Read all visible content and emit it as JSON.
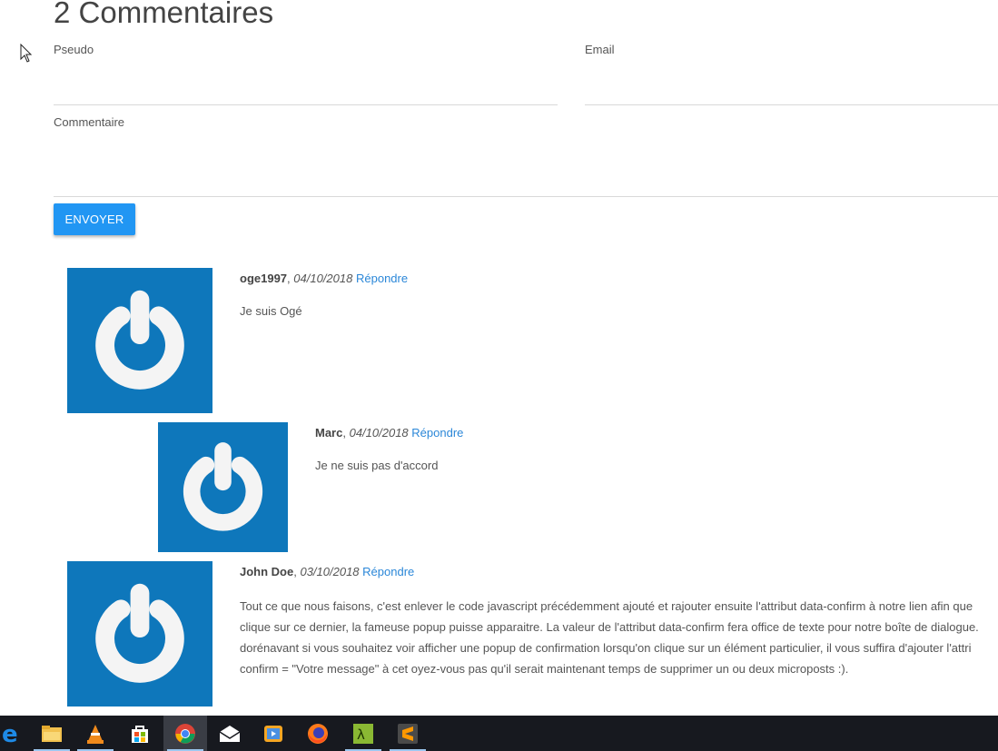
{
  "section": {
    "title": "2 Commentaires"
  },
  "form": {
    "pseudo_label": "Pseudo",
    "email_label": "Email",
    "comment_label": "Commentaire",
    "submit_label": "ENVOYER"
  },
  "comments": [
    {
      "author": "oge1997",
      "date": "04/10/2018",
      "reply": "Répondre",
      "text": "Je suis Ogé"
    },
    {
      "author": "Marc",
      "date": "04/10/2018",
      "reply": "Répondre",
      "text": "Je ne suis pas d'accord"
    },
    {
      "author": "John Doe",
      "date": "03/10/2018",
      "reply": "Répondre",
      "text_lines": [
        "Tout ce que nous faisons, c'est enlever le code javascript précédemment ajouté et rajouter ensuite l'attribut data-confirm à notre lien afin que",
        "clique sur ce dernier, la fameuse popup puisse apparaitre. La valeur de l'attribut data-confirm fera office de texte pour notre boîte de dialogue.",
        "dorénavant si vous souhaitez voir afficher une popup de confirmation lorsqu'on clique sur un élément particulier, il vous suffira d'ajouter l'attri",
        "confirm = \"Votre message\" à cet oyez-vous pas qu'il serait maintenant temps de supprimer un ou deux microposts :)."
      ]
    }
  ],
  "colors": {
    "accent": "#2196f3",
    "avatar_bg": "#0e77bb",
    "link": "#2b87d8",
    "taskbar": "#17191f"
  },
  "taskbar": {
    "icons": [
      "edge-icon",
      "file-explorer-icon",
      "vlc-icon",
      "store-icon",
      "chrome-icon",
      "mail-icon",
      "media-player-icon",
      "firefox-icon",
      "terminal-icon",
      "sublime-text-icon"
    ]
  }
}
